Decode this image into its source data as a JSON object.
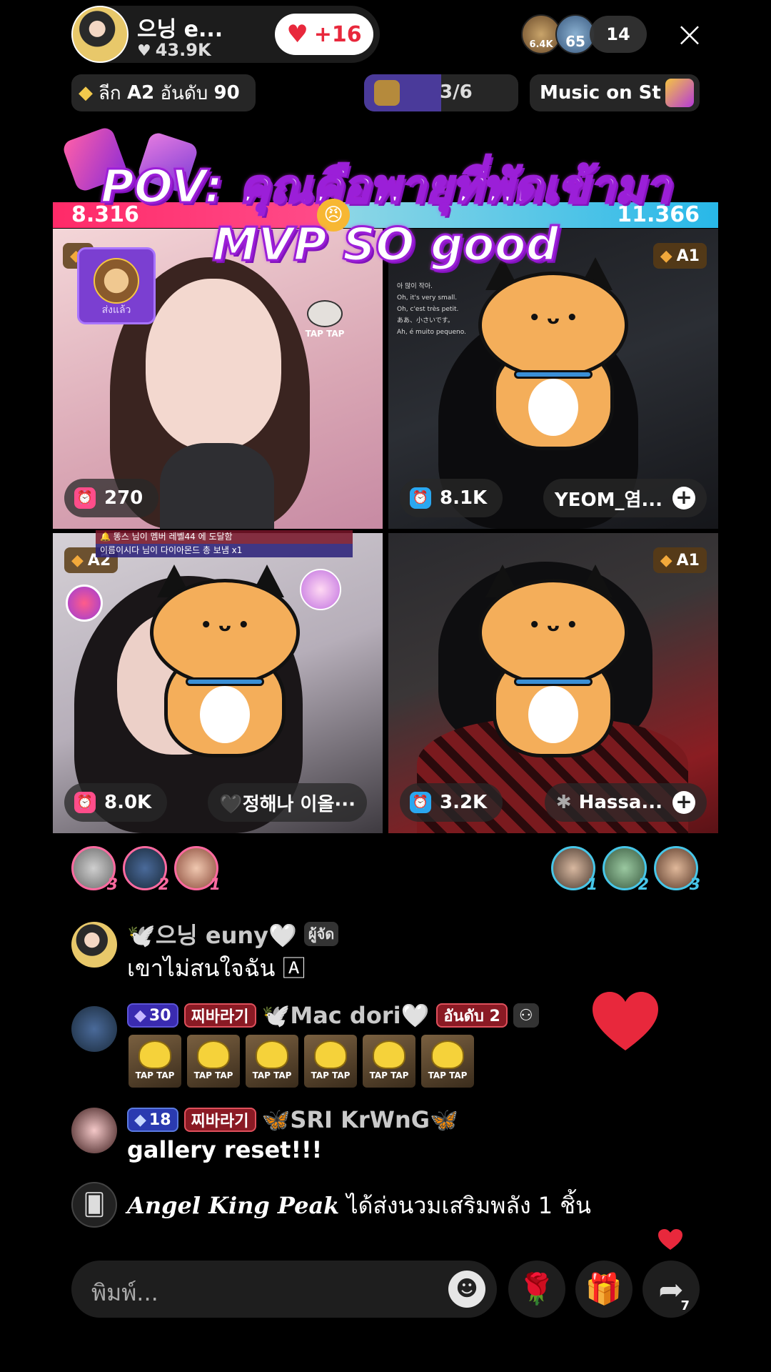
{
  "host": {
    "name": "으닝 e...",
    "likes": "43.9K",
    "like_button": "+16"
  },
  "viewers": {
    "avatar_badges": [
      "6.4K",
      "65"
    ],
    "count": "14"
  },
  "close_icon": "×",
  "league": {
    "label": "ลีก",
    "tier": "A2",
    "rank_label": "อันดับ",
    "rank": "90"
  },
  "round": {
    "text": "3/6",
    "progress": 0.5
  },
  "music": {
    "label": "Music on St"
  },
  "battle": {
    "left_score": "8.316",
    "right_score": "11.366",
    "left_share": 0.422
  },
  "overlay": {
    "line1": "POV: คุณคือพายุที่พัดเข้ามา",
    "line2": "MVP SO good"
  },
  "tiles": [
    {
      "score": "270",
      "score_color": "pink",
      "sent_label": "ส่งแล้ว",
      "sticker_label": "TAP TAP"
    },
    {
      "score": "8.1K",
      "score_color": "blue",
      "badge": "A1",
      "name": "YEOM_염...",
      "subtitles": [
        "아 많이 작아.",
        "Oh, it's very small.",
        "Oh, c'est très petit.",
        "ああ、小さいです。",
        "Ah, é muito pequeno."
      ]
    },
    {
      "score": "8.0K",
      "score_color": "pink",
      "badge": "A2",
      "name": "🖤정해나 이올···",
      "notice1": "🔔 똥스  님이 멤버 레벨44 에 도달함",
      "notice2": "이름이시다  님이 다이아몬드 총 보냄  x1"
    },
    {
      "score": "3.2K",
      "score_color": "blue",
      "badge": "A1",
      "name": "Hassa..."
    }
  ],
  "contributors": {
    "left": [
      {
        "rank": "3"
      },
      {
        "rank": "2"
      },
      {
        "rank": "1"
      }
    ],
    "right": [
      {
        "rank": "1"
      },
      {
        "rank": "2"
      },
      {
        "rank": "3"
      }
    ]
  },
  "comments": [
    {
      "username": "🕊️으닝 euny🤍",
      "host_tag": "ผู้จัด",
      "message": "เขาไม่สนใจฉัน 🄰"
    },
    {
      "level": "30",
      "fan_tag": "찌바라기",
      "username": "🕊️Mac dori🤍",
      "rank_tag": "อันดับ 2",
      "gifts": [
        "TAP TAP",
        "TAP TAP",
        "TAP TAP",
        "TAP TAP",
        "TAP TAP",
        "TAP TAP"
      ]
    },
    {
      "level": "18",
      "fan_tag": "찌바라기",
      "username": "🦋SRI KrWnG🦋",
      "message": "gallery reset!!!"
    }
  ],
  "system_message": {
    "giver": "Angel King Peak",
    "text": " ได้ส่งนวมเสริมพลัง 1 ชิ้น"
  },
  "input": {
    "placeholder": "พิมพ์..."
  },
  "share_count": "7",
  "colors": {
    "battle_left": "#ff2a68",
    "battle_right": "#28b8e8",
    "title_stroke": "#9b1fd8",
    "heart": "#e8283c"
  }
}
